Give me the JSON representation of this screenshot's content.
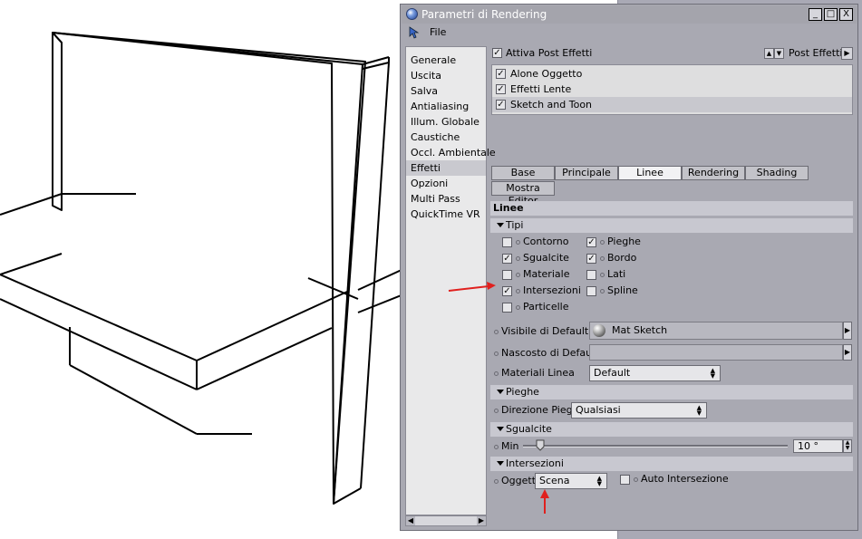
{
  "window": {
    "title": "Parametri di Rendering",
    "minimize_glyph": "_",
    "maximize_glyph": "□",
    "close_glyph": "X"
  },
  "menu": {
    "file_label": "File"
  },
  "sidebar": {
    "items": [
      {
        "label": "Generale",
        "selected": false
      },
      {
        "label": "Uscita",
        "selected": false
      },
      {
        "label": "Salva",
        "selected": false
      },
      {
        "label": "Antialiasing",
        "selected": false
      },
      {
        "label": "Illum. Globale",
        "selected": false
      },
      {
        "label": "Caustiche",
        "selected": false
      },
      {
        "label": "Occl. Ambientale",
        "selected": false
      },
      {
        "label": "Effetti",
        "selected": true
      },
      {
        "label": "Opzioni",
        "selected": false
      },
      {
        "label": "Multi Pass",
        "selected": false
      },
      {
        "label": "QuickTime VR",
        "selected": false
      }
    ]
  },
  "post": {
    "enable_label": "Attiva Post Effetti",
    "enable_checked": true,
    "dropdown_label": "Post Effetti",
    "effects": [
      {
        "label": "Alone Oggetto",
        "checked": true,
        "selected": false
      },
      {
        "label": "Effetti Lente",
        "checked": true,
        "selected": false
      },
      {
        "label": "Sketch and Toon",
        "checked": true,
        "selected": true
      }
    ]
  },
  "tabs": [
    {
      "label": "Base",
      "selected": false
    },
    {
      "label": "Principale",
      "selected": false
    },
    {
      "label": "Linee",
      "selected": true
    },
    {
      "label": "Rendering",
      "selected": false
    },
    {
      "label": "Shading",
      "selected": false
    }
  ],
  "mostra_editor": "Mostra Editor",
  "linee": {
    "header": "Linee",
    "tipi_header": "Tipi",
    "tipi_left": [
      {
        "label": "Contorno",
        "checked": false
      },
      {
        "label": "Sgualcite",
        "checked": true
      },
      {
        "label": "Materiale",
        "checked": false
      },
      {
        "label": "Intersezioni",
        "checked": true
      },
      {
        "label": "Particelle",
        "checked": false
      }
    ],
    "tipi_right": [
      {
        "label": "Pieghe",
        "checked": true
      },
      {
        "label": "Bordo",
        "checked": true
      },
      {
        "label": "Lati",
        "checked": false
      },
      {
        "label": "Spline",
        "checked": false
      }
    ],
    "visibile_label": "Visibile di Default",
    "visibile_value": "Mat Sketch",
    "nascosto_label": "Nascosto di Default",
    "nascosto_value": "",
    "materiali_label": "Materiali Linea",
    "materiali_value": "Default"
  },
  "pieghe": {
    "header": "Pieghe",
    "direzione_label": "Direzione Piega",
    "direzione_value": "Qualsiasi"
  },
  "sgualcite": {
    "header": "Sgualcite",
    "min_label": "Min",
    "min_value": "10 °"
  },
  "intersezioni": {
    "header": "Intersezioni",
    "oggetti_label": "Oggetti",
    "oggetti_value": "Scena",
    "auto_label": "Auto Intersezione",
    "auto_checked": false
  },
  "colors": {
    "annotation_arrow": "#e0201e",
    "window_bg": "#a9a9b2",
    "section_bg": "#c8c8d0"
  }
}
